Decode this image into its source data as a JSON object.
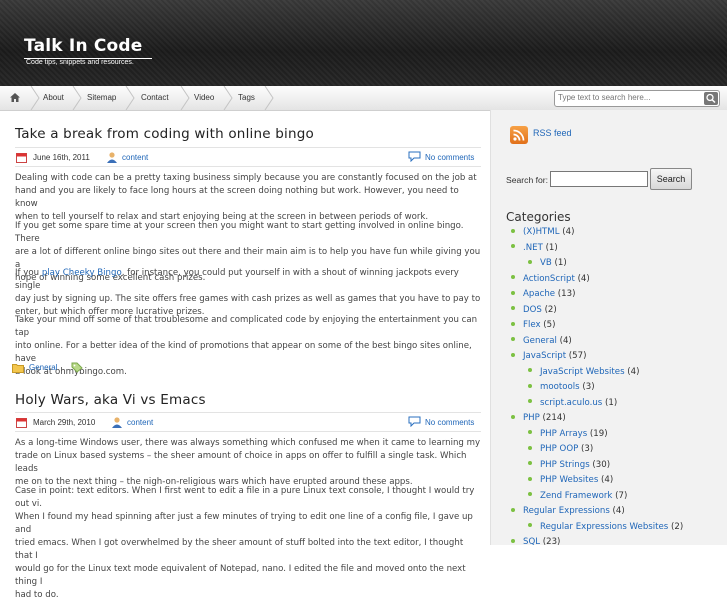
{
  "header": {
    "site_title": "Talk In Code",
    "tagline": "Code tips, snippets and resources."
  },
  "nav": {
    "items": [
      "About",
      "Sitemap",
      "Contact",
      "Video",
      "Tags"
    ],
    "search_placeholder": "Type text to search here..."
  },
  "posts": [
    {
      "title": "Take a break from coding with online bingo",
      "date": "June 16th, 2011",
      "author": "content",
      "comments": "No comments",
      "paragraphs": [
        {
          "lines": [
            "Dealing with code can be a pretty taxing business simply because you are constantly focused on the job at",
            "hand and you are likely to face long hours at the screen doing nothing but work. However, you need to know",
            "when to tell yourself to relax and start enjoying being at the screen in between periods of work."
          ]
        },
        {
          "lines": [
            "If you get some spare time at your screen then you might want to start getting involved in online bingo. There",
            "are a lot of different online bingo sites out there and their main aim is to help you have fun while giving you a",
            "hope of winning some excellent cash prizes."
          ]
        },
        {
          "lines": [
            "If you ",
            "play Cheeky Bingo",
            ", for instance, you could put yourself in with a shout of winning jackpots every single",
            "day just by signing up. The site offers free games with cash prizes as well as games that you have to pay to",
            "enter, but which offer more lucrative prizes."
          ]
        },
        {
          "lines": [
            "Take your mind off some of that troublesome and complicated code by enjoying the entertainment you can tap",
            "into online. For a better idea of the kind of promotions that appear on some of the best bingo sites online, have",
            "a look at ohmybingo.com."
          ]
        }
      ],
      "category": "General"
    },
    {
      "title": "Holy Wars, aka Vi vs Emacs",
      "date": "March 29th, 2010",
      "author": "content",
      "comments": "No comments",
      "paragraphs": [
        {
          "lines": [
            "As a long-time Windows user, there was always something which confused me when it came to learning my",
            "trade on Linux based systems – the sheer amount of choice in apps on offer to fulfill a single task. Which leads",
            "me on to the next thing – the nigh-on-religious wars which have erupted around these apps."
          ]
        },
        {
          "lines": [
            "Case in point: text editors. When I first went to edit a file in a pure Linux text console, I thought I would try out vi.",
            "When I found my head spinning after just a few minutes of trying to edit one line of a config file, I gave up and",
            "tried emacs. When I got overwhelmed by the sheer amount of stuff bolted into the text editor, I thought that I",
            "would go for the Linux text mode equivalent of Notepad, nano. I edited the file and moved onto the next thing I",
            "had to do."
          ]
        }
      ]
    }
  ],
  "sidebar": {
    "rss_label": "RSS feed",
    "search_label": "Search for:",
    "search_button": "Search",
    "categories_heading": "Categories",
    "categories": [
      {
        "name": "(X)HTML",
        "count": "(4)",
        "level": 0
      },
      {
        "name": ".NET",
        "count": "(1)",
        "level": 0
      },
      {
        "name": "VB",
        "count": "(1)",
        "level": 1
      },
      {
        "name": "ActionScript",
        "count": "(4)",
        "level": 0
      },
      {
        "name": "Apache",
        "count": "(13)",
        "level": 0
      },
      {
        "name": "DOS",
        "count": "(2)",
        "level": 0
      },
      {
        "name": "Flex",
        "count": "(5)",
        "level": 0
      },
      {
        "name": "General",
        "count": "(4)",
        "level": 0
      },
      {
        "name": "JavaScript",
        "count": "(57)",
        "level": 0
      },
      {
        "name": "JavaScript Websites",
        "count": "(4)",
        "level": 1
      },
      {
        "name": "mootools",
        "count": "(3)",
        "level": 1
      },
      {
        "name": "script.aculo.us",
        "count": "(1)",
        "level": 1
      },
      {
        "name": "PHP",
        "count": "(214)",
        "level": 0
      },
      {
        "name": "PHP Arrays",
        "count": "(19)",
        "level": 1
      },
      {
        "name": "PHP OOP",
        "count": "(3)",
        "level": 1
      },
      {
        "name": "PHP Strings",
        "count": "(30)",
        "level": 1
      },
      {
        "name": "PHP Websites",
        "count": "(4)",
        "level": 1
      },
      {
        "name": "Zend Framework",
        "count": "(7)",
        "level": 1
      },
      {
        "name": "Regular Expressions",
        "count": "(4)",
        "level": 0
      },
      {
        "name": "Regular Expressions Websites",
        "count": "(2)",
        "level": 1
      },
      {
        "name": "SQL",
        "count": "(23)",
        "level": 0
      }
    ]
  }
}
